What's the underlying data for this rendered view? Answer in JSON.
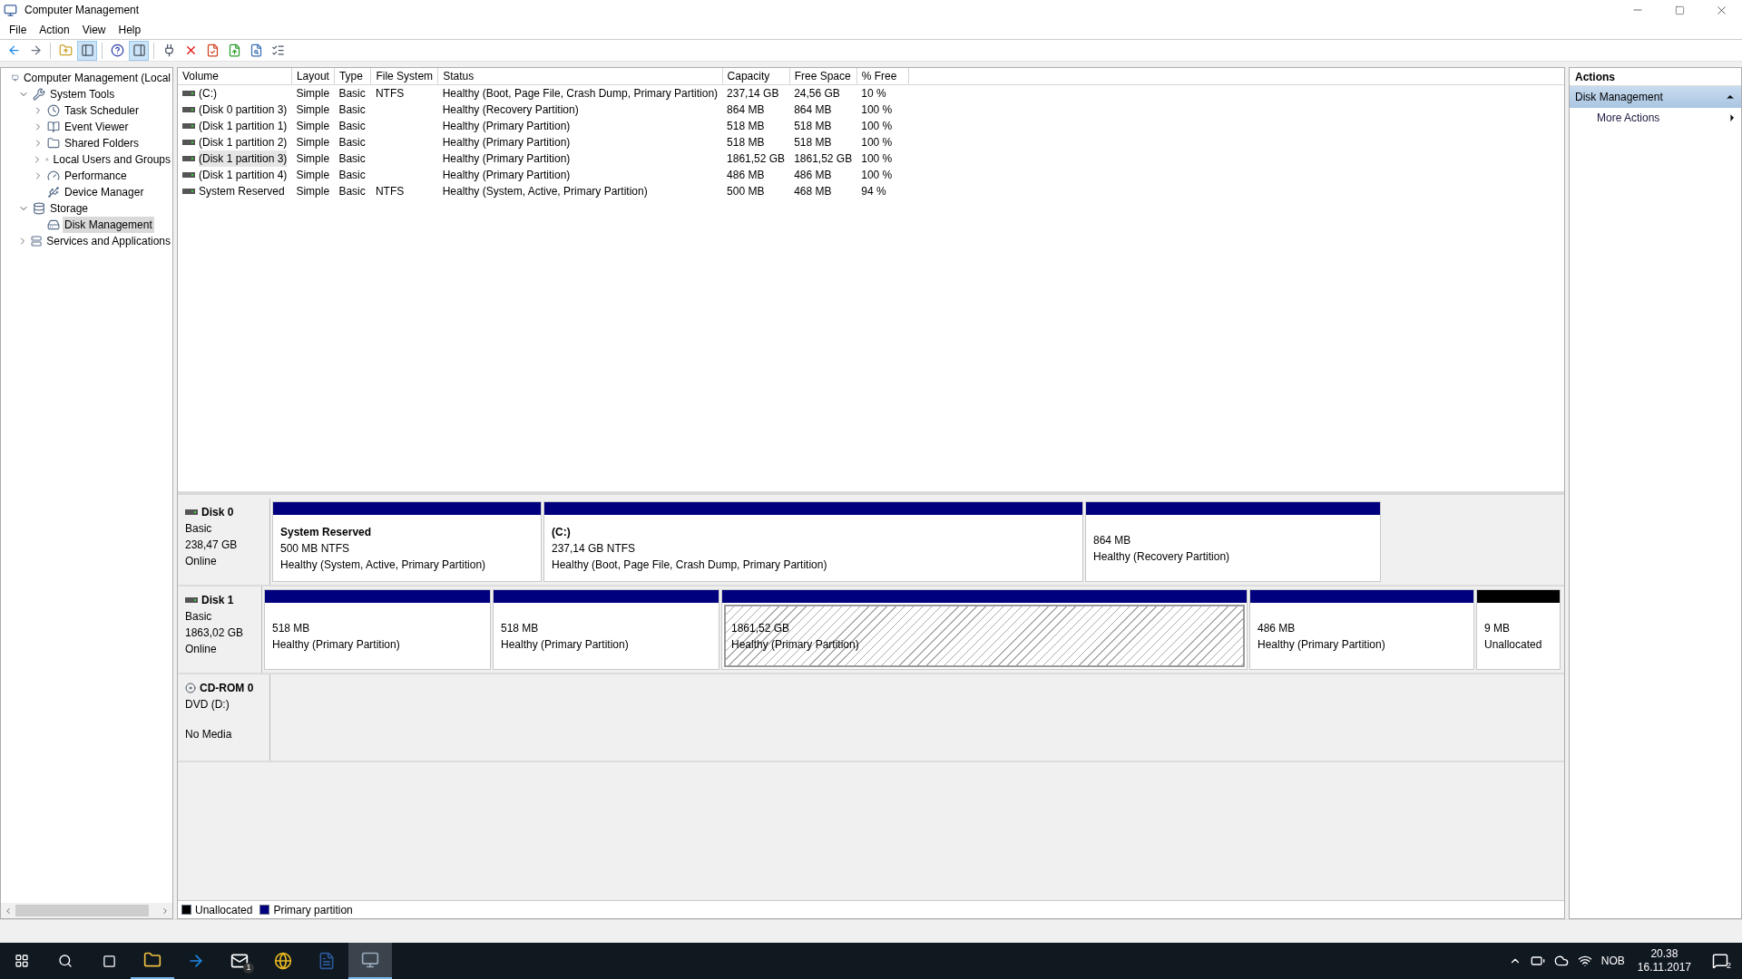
{
  "window": {
    "title": "Computer Management"
  },
  "menu": [
    {
      "label": "File"
    },
    {
      "label": "Action"
    },
    {
      "label": "View"
    },
    {
      "label": "Help"
    }
  ],
  "toolbar": [
    {
      "kind": "back",
      "pressed": false
    },
    {
      "kind": "forward",
      "pressed": false
    },
    {
      "kind": "sep"
    },
    {
      "kind": "up",
      "pressed": false
    },
    {
      "kind": "tree",
      "pressed": true
    },
    {
      "kind": "sep"
    },
    {
      "kind": "help",
      "pressed": false
    },
    {
      "kind": "actionpane",
      "pressed": true
    },
    {
      "kind": "sep"
    },
    {
      "kind": "connect",
      "pressed": false
    },
    {
      "kind": "delete",
      "pressed": false
    },
    {
      "kind": "properties",
      "pressed": false
    },
    {
      "kind": "export",
      "pressed": false
    },
    {
      "kind": "find",
      "pressed": false
    },
    {
      "kind": "list",
      "pressed": false
    }
  ],
  "tree": [
    {
      "label": "Computer Management (Local",
      "selected": false,
      "children": [
        {
          "label": "System Tools",
          "expanded": true,
          "selected": false,
          "children": [
            {
              "label": "Task Scheduler",
              "expanded": false,
              "selected": false
            },
            {
              "label": "Event Viewer",
              "expanded": false,
              "selected": false
            },
            {
              "label": "Shared Folders",
              "expanded": false,
              "selected": false
            },
            {
              "label": "Local Users and Groups",
              "expanded": false,
              "selected": false
            },
            {
              "label": "Performance",
              "expanded": false,
              "selected": false
            },
            {
              "label": "Device Manager",
              "selected": false
            }
          ]
        },
        {
          "label": "Storage",
          "expanded": true,
          "selected": false,
          "children": [
            {
              "label": "Disk Management",
              "selected": true
            }
          ]
        },
        {
          "label": "Services and Applications",
          "expanded": false,
          "selected": false
        }
      ]
    }
  ],
  "table": {
    "columns": [
      "Volume",
      "Layout",
      "Type",
      "File System",
      "Status",
      "Capacity",
      "Free Space",
      "% Free"
    ],
    "rows": [
      {
        "cells": [
          "(C:)",
          "Simple",
          "Basic",
          "NTFS",
          "Healthy (Boot, Page File, Crash Dump, Primary Partition)",
          "237,14 GB",
          "24,56 GB",
          "10 %"
        ],
        "selected": false
      },
      {
        "cells": [
          "(Disk 0 partition 3)",
          "Simple",
          "Basic",
          "",
          "Healthy (Recovery Partition)",
          "864 MB",
          "864 MB",
          "100 %"
        ],
        "selected": false
      },
      {
        "cells": [
          "(Disk 1 partition 1)",
          "Simple",
          "Basic",
          "",
          "Healthy (Primary Partition)",
          "518 MB",
          "518 MB",
          "100 %"
        ],
        "selected": false
      },
      {
        "cells": [
          "(Disk 1 partition 2)",
          "Simple",
          "Basic",
          "",
          "Healthy (Primary Partition)",
          "518 MB",
          "518 MB",
          "100 %"
        ],
        "selected": false
      },
      {
        "cells": [
          "(Disk 1 partition 3)",
          "Simple",
          "Basic",
          "",
          "Healthy (Primary Partition)",
          "1861,52 GB",
          "1861,52 GB",
          "100 %"
        ],
        "selected": true
      },
      {
        "cells": [
          "(Disk 1 partition 4)",
          "Simple",
          "Basic",
          "",
          "Healthy (Primary Partition)",
          "486 MB",
          "486 MB",
          "100 %"
        ],
        "selected": false
      },
      {
        "cells": [
          "System Reserved",
          "Simple",
          "Basic",
          "NTFS",
          "Healthy (System, Active, Primary Partition)",
          "500 MB",
          "468 MB",
          "94 %"
        ],
        "selected": false
      }
    ]
  },
  "disks": [
    {
      "name": "Disk 0",
      "kind": "disk",
      "type": "Basic",
      "size": "238,47 GB",
      "status": "Online",
      "partitions": [
        {
          "name": "System Reserved",
          "size": "500 MB NTFS",
          "status": "Healthy (System, Active, Primary Partition)",
          "kind": "primary",
          "selected": false
        },
        {
          "name": "(C:)",
          "size": "237,14 GB NTFS",
          "status": "Healthy (Boot, Page File, Crash Dump, Primary Partition)",
          "kind": "primary",
          "selected": false
        },
        {
          "size": "864 MB",
          "status": "Healthy (Recovery Partition)",
          "kind": "primary",
          "selected": false
        }
      ]
    },
    {
      "name": "Disk 1",
      "kind": "disk",
      "type": "Basic",
      "size": "1863,02 GB",
      "status": "Online",
      "partitions": [
        {
          "size": "518 MB",
          "status": "Healthy (Primary Partition)",
          "kind": "primary",
          "selected": false
        },
        {
          "size": "518 MB",
          "status": "Healthy (Primary Partition)",
          "kind": "primary",
          "selected": false
        },
        {
          "size": "1861,52 GB",
          "status": "Healthy (Primary Partition)",
          "kind": "primary",
          "selected": true
        },
        {
          "size": "486 MB",
          "status": "Healthy (Primary Partition)",
          "kind": "primary",
          "selected": false
        },
        {
          "size": "9 MB",
          "status": "Unallocated",
          "kind": "unallocated",
          "selected": false
        }
      ]
    },
    {
      "name": "CD-ROM 0",
      "kind": "cdrom",
      "type": "DVD (D:)",
      "status": "No Media"
    }
  ],
  "legend": [
    {
      "label": "Unallocated",
      "color": "#000000"
    },
    {
      "label": "Primary partition",
      "color": "#00007f"
    }
  ],
  "actions": {
    "title": "Actions",
    "section": "Disk Management",
    "items": [
      {
        "label": "More Actions"
      }
    ]
  },
  "taskbar": {
    "apps": [
      {
        "kind": "explorer",
        "active": false,
        "running": true
      },
      {
        "kind": "remote",
        "active": false,
        "running": false
      },
      {
        "kind": "mail",
        "active": false,
        "running": false,
        "badge": "1"
      },
      {
        "kind": "browser",
        "active": false,
        "running": false
      },
      {
        "kind": "word",
        "active": false,
        "running": false
      },
      {
        "kind": "mmc",
        "active": true,
        "running": true
      }
    ],
    "language": "NOB",
    "time": "20.38",
    "date": "16.11.2017",
    "notifications": "2"
  }
}
